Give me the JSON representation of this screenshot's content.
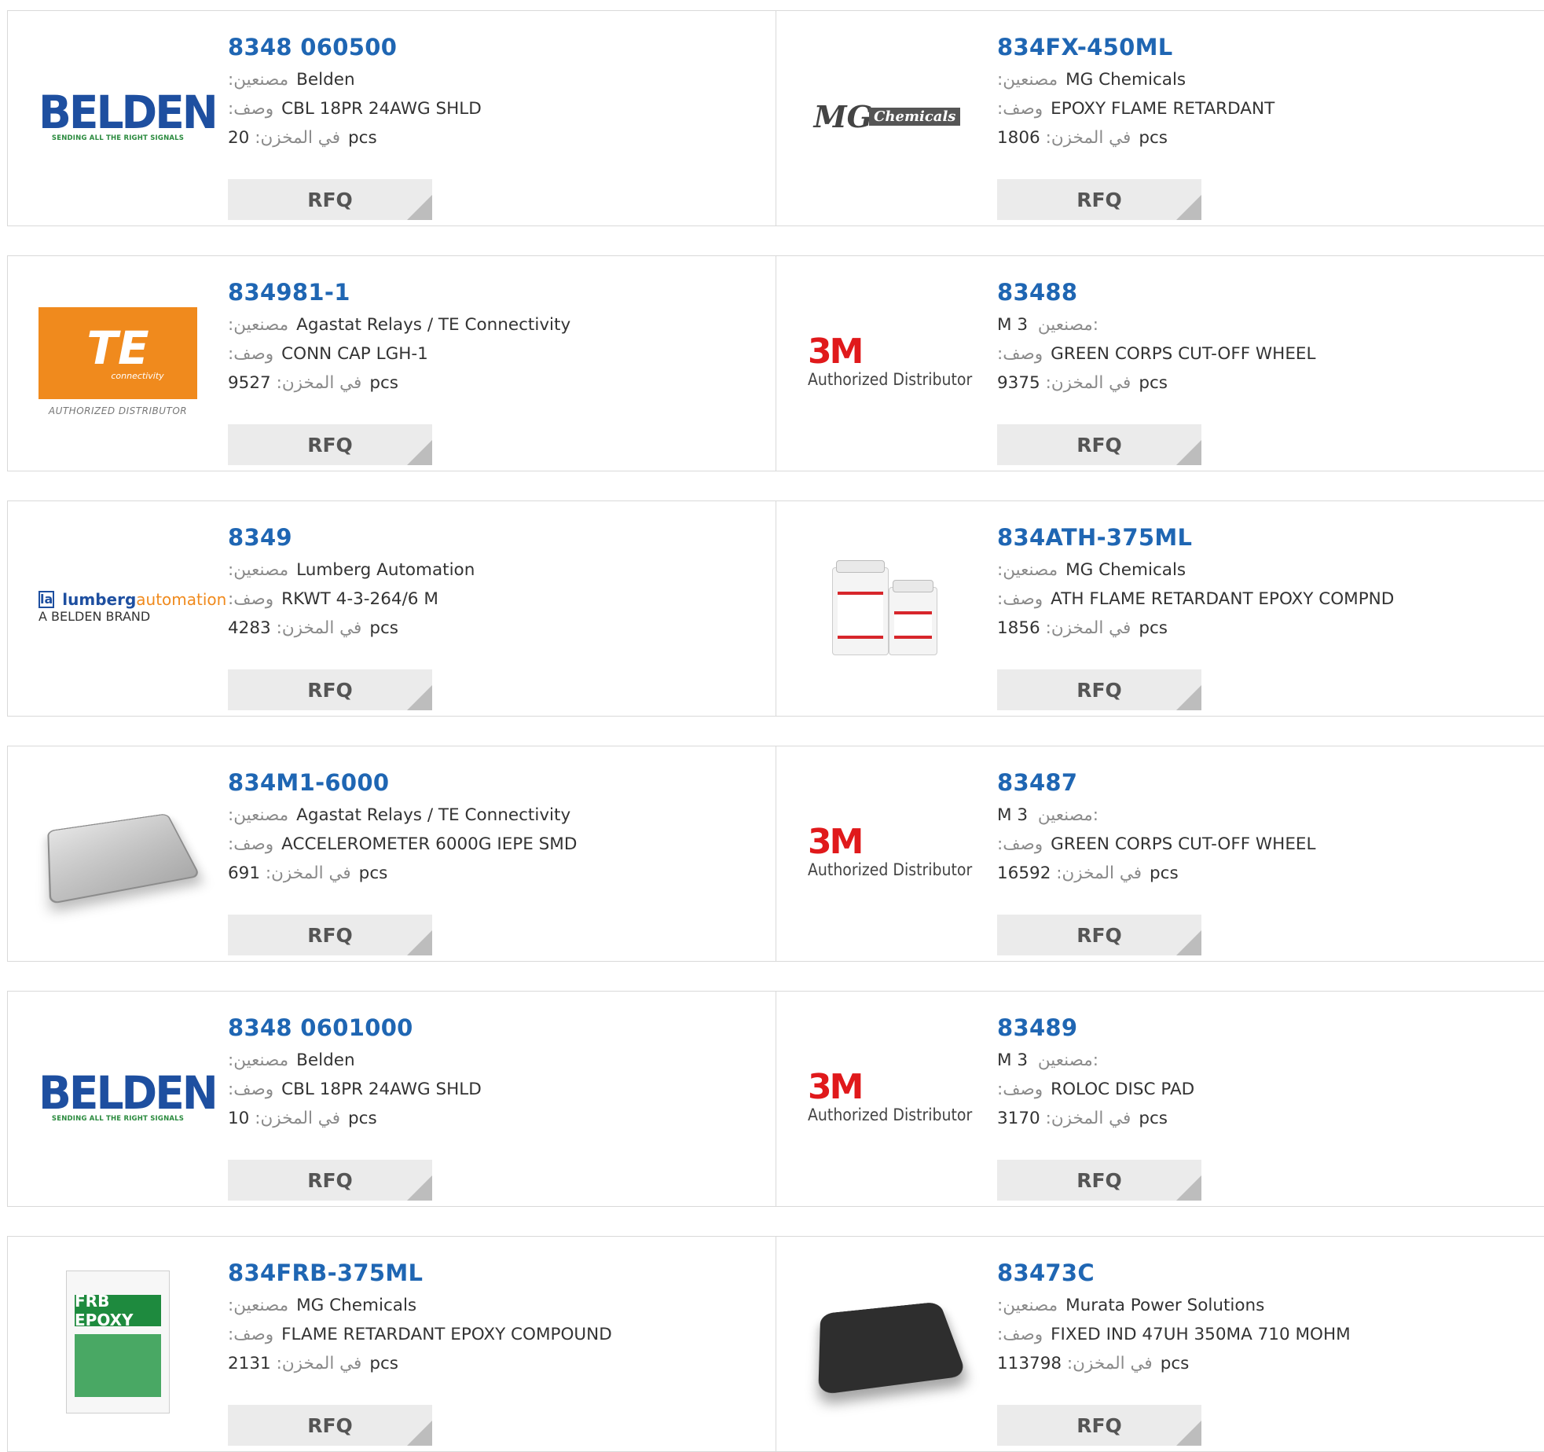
{
  "labels": {
    "manufacturer": ":مصنعين",
    "description": ":وصف",
    "stock": ":في المخزن",
    "unit": "pcs",
    "rfq": "RFQ"
  },
  "rows": [
    {
      "left": {
        "part_number": "8348 060500",
        "manufacturer": "Belden",
        "description": "CBL 18PR 24AWG SHLD",
        "stock": "20",
        "logo": "belden-logo",
        "logo_text": "BELDEN",
        "logo_tagline": "SENDING ALL THE RIGHT SIGNALS"
      },
      "right": {
        "part_number": "834FX-450ML",
        "manufacturer": "MG Chemicals",
        "description": "EPOXY FLAME RETARDANT",
        "stock": "1806",
        "logo": "mg-chemicals-logo",
        "logo_text_a": "MG",
        "logo_text_b": "Chemicals"
      }
    },
    {
      "left": {
        "part_number": "834981-1",
        "manufacturer": "Agastat Relays / TE Connectivity",
        "description": "CONN CAP LGH-1",
        "stock": "9527",
        "logo": "te-connectivity-logo",
        "logo_text": "TE",
        "logo_sub": "connectivity",
        "logo_auth": "AUTHORIZED DISTRIBUTOR"
      },
      "right": {
        "part_number": "83488",
        "manufacturer": "M 3",
        "manufacturer_label": "مصنعين:",
        "description": "GREEN CORPS CUT-OFF WHEEL",
        "stock": "9375",
        "logo": "3m-logo",
        "logo_text": "3M",
        "logo_auth": "Authorized Distributor"
      }
    },
    {
      "left": {
        "part_number": "8349",
        "manufacturer": "Lumberg Automation",
        "description": "RKWT 4-3-264/6 M",
        "stock": "4283",
        "logo": "lumberg-automation-logo",
        "logo_box": "la",
        "logo_text_a": "lumberg",
        "logo_text_b": "automation",
        "logo_sub": "A BELDEN BRAND"
      },
      "right": {
        "part_number": "834ATH-375ML",
        "manufacturer": "MG Chemicals",
        "description": "ATH FLAME RETARDANT EPOXY COMPND",
        "stock": "1856",
        "logo": "epoxy-jars-image"
      }
    },
    {
      "left": {
        "part_number": "834M1-6000",
        "manufacturer": "Agastat Relays / TE Connectivity",
        "description": "ACCELEROMETER 6000G IEPE SMD",
        "stock": "691",
        "logo": "accelerometer-image"
      },
      "right": {
        "part_number": "83487",
        "manufacturer": "M 3",
        "manufacturer_label": "مصنعين:",
        "description": "GREEN CORPS CUT-OFF WHEEL",
        "stock": "16592",
        "logo": "3m-logo",
        "logo_text": "3M",
        "logo_auth": "Authorized Distributor"
      }
    },
    {
      "left": {
        "part_number": "8348 0601000",
        "manufacturer": "Belden",
        "description": "CBL 18PR 24AWG SHLD",
        "stock": "10",
        "logo": "belden-logo",
        "logo_text": "BELDEN",
        "logo_tagline": "SENDING ALL THE RIGHT SIGNALS"
      },
      "right": {
        "part_number": "83489",
        "manufacturer": "M 3",
        "manufacturer_label": "مصنعين:",
        "description": "ROLOC DISC PAD",
        "stock": "3170",
        "logo": "3m-logo",
        "logo_text": "3M",
        "logo_auth": "Authorized Distributor"
      }
    },
    {
      "left": {
        "part_number": "834FRB-375ML",
        "manufacturer": "MG Chemicals",
        "description": "FLAME RETARDANT EPOXY COMPOUND",
        "stock": "2131",
        "logo": "epoxy-box-image",
        "logo_text": "FRB EPOXY"
      },
      "right": {
        "part_number": "83473C",
        "manufacturer": "Murata Power Solutions",
        "description": "FIXED IND 47UH 350MA 710 MOHM",
        "stock": "113798",
        "logo": "inductor-image"
      }
    }
  ],
  "colors": {
    "part_link": "#1f66b3",
    "label": "#8a8a8a",
    "border": "#d9d9d9",
    "rfq_bg": "#ebebeb"
  }
}
